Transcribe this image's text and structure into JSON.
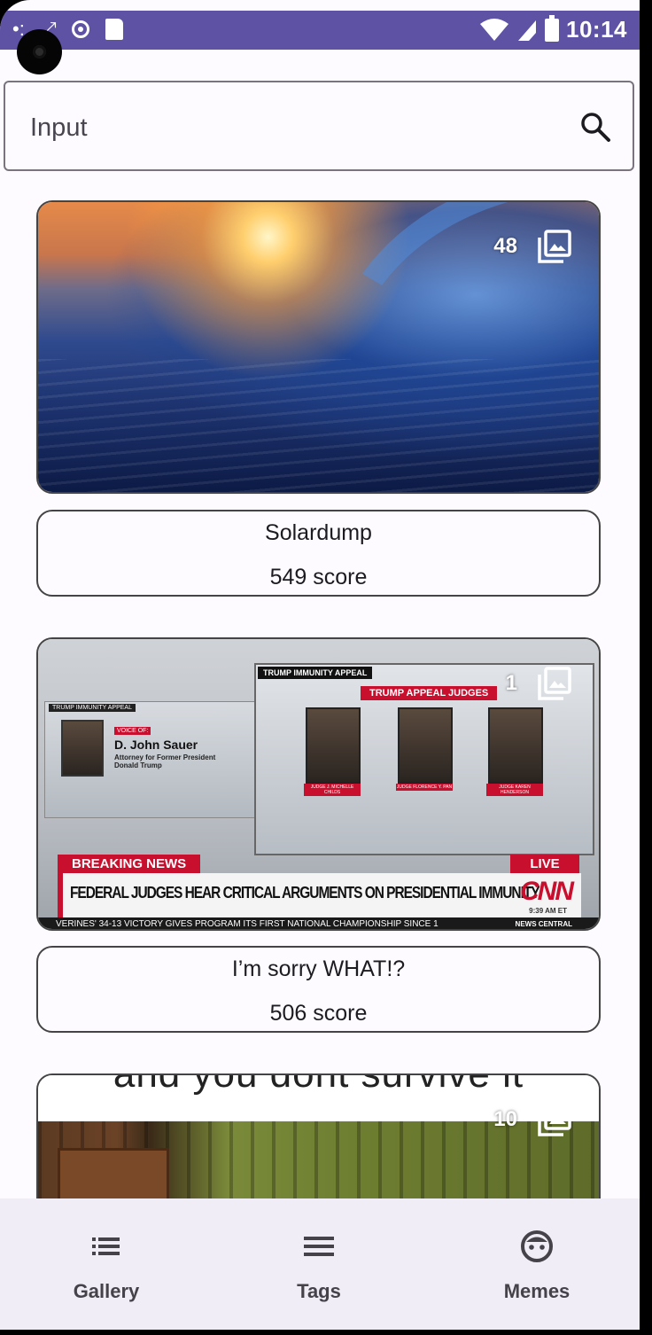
{
  "status_bar": {
    "time": "10:14"
  },
  "search": {
    "placeholder": "Input",
    "value": ""
  },
  "posts": [
    {
      "title": "Solardump",
      "score": "549 score",
      "image_count": "48"
    },
    {
      "title": "I’m sorry WHAT!?",
      "score": "506 score",
      "image_count": "1",
      "image_text": {
        "left_tag": "TRUMP IMMUNITY APPEAL",
        "voice_of": "VOICE OF:",
        "person_name": "D. John Sauer",
        "person_desc": "Attorney for Former President Donald Trump",
        "right_tag": "TRUMP IMMUNITY APPEAL",
        "judges_tag": "TRUMP APPEAL JUDGES",
        "judges": [
          "JUDGE J. MICHELLE CHILDS",
          "JUDGE FLORENCE Y. PAN",
          "JUDGE KAREN HENDERSON"
        ],
        "breaking": "BREAKING NEWS",
        "live": "LIVE",
        "headline": "FEDERAL JUDGES HEAR CRITICAL ARGUMENTS ON PRESIDENTIAL IMMUNITY",
        "network": "CNN",
        "timestamp": "9:39 AM ET",
        "ticker": "VERINES' 34-13 VICTORY GIVES PROGRAM ITS FIRST NATIONAL CHAMPIONSHIP SINCE 1",
        "ticker_tag": "NEWS CENTRAL"
      }
    },
    {
      "title": "",
      "score": "",
      "image_count": "10",
      "image_text": "and you dont survive it"
    }
  ],
  "bottom_nav": [
    {
      "label": "Gallery",
      "icon": "list-icon"
    },
    {
      "label": "Tags",
      "icon": "menu-icon"
    },
    {
      "label": "Memes",
      "icon": "face-icon"
    }
  ],
  "colors": {
    "status_bar": "#5e52a4",
    "background": "#fdfbff",
    "nav_background": "#f1edf6"
  }
}
